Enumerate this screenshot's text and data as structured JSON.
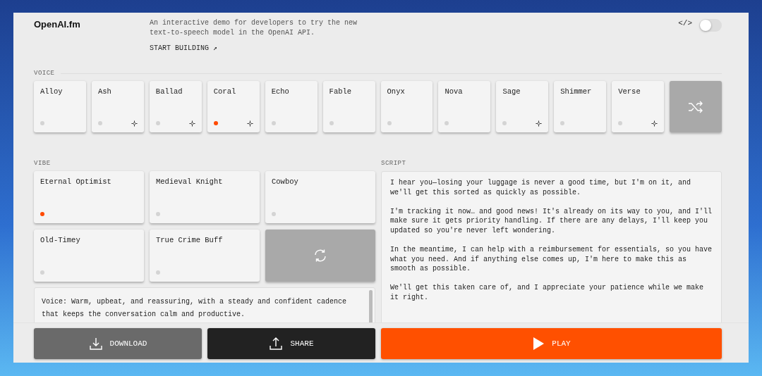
{
  "header": {
    "logo": "OpenAI.fm",
    "description": "An interactive demo for developers to try the new text-to-speech model in the OpenAI API.",
    "link": "START BUILDING ↗",
    "code_toggle": {
      "label": "</>",
      "on": false
    }
  },
  "voice": {
    "label": "VOICE",
    "items": [
      {
        "name": "Alloy",
        "selected": false,
        "featured": false
      },
      {
        "name": "Ash",
        "selected": false,
        "featured": true
      },
      {
        "name": "Ballad",
        "selected": false,
        "featured": true
      },
      {
        "name": "Coral",
        "selected": true,
        "featured": true
      },
      {
        "name": "Echo",
        "selected": false,
        "featured": false
      },
      {
        "name": "Fable",
        "selected": false,
        "featured": false
      },
      {
        "name": "Onyx",
        "selected": false,
        "featured": false
      },
      {
        "name": "Nova",
        "selected": false,
        "featured": false
      },
      {
        "name": "Sage",
        "selected": false,
        "featured": true
      },
      {
        "name": "Shimmer",
        "selected": false,
        "featured": false
      },
      {
        "name": "Verse",
        "selected": false,
        "featured": true
      }
    ]
  },
  "vibe": {
    "label": "VIBE",
    "items": [
      {
        "name": "Eternal Optimist",
        "selected": true
      },
      {
        "name": "Medieval Knight",
        "selected": false
      },
      {
        "name": "Cowboy",
        "selected": false
      },
      {
        "name": "Old-Timey",
        "selected": false
      },
      {
        "name": "True Crime Buff",
        "selected": false
      }
    ],
    "description": "Voice: Warm, upbeat, and reassuring, with a steady and confident cadence that keeps the conversation calm and productive."
  },
  "script": {
    "label": "SCRIPT",
    "paragraphs": [
      "I hear you—losing your luggage is never a good time, but I'm on it, and we'll get this sorted as quickly as possible.",
      "I'm tracking it now… and good news! It's already on its way to you, and I'll make sure it gets priority handling. If there are any delays, I'll keep you updated so you're never left wondering.",
      "In the meantime, I can help with a reimbursement for essentials, so you have what you need. And if anything else comes up, I'm here to make this as smooth as possible.",
      "We'll get this taken care of, and I appreciate your patience while we make it right."
    ]
  },
  "actions": [
    {
      "kind": "download",
      "label": "DOWNLOAD"
    },
    {
      "kind": "share",
      "label": "SHARE"
    },
    {
      "kind": "play",
      "label": "PLAY"
    }
  ]
}
